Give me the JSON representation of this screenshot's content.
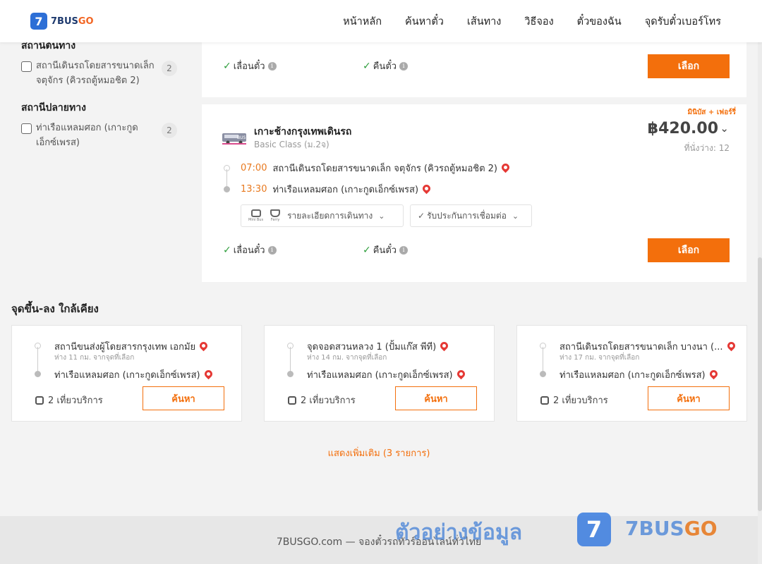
{
  "brand": {
    "logo_mark": "7",
    "name_main": "7BUS",
    "name_go": "GO"
  },
  "nav": [
    "หน้าหลัก",
    "ค้นหาตั๋ว",
    "เส้นทาง",
    "วิธีจอง",
    "ตั๋วของฉัน",
    "จุดรับตั๋วเบอร์โทร"
  ],
  "filters": {
    "origin": {
      "title": "สถานีต้นทาง",
      "items": [
        {
          "label": "สถานีเดินรถโดยสารขนาดเล็ก จตุจักร (คิวรถตู้หมอชิต 2)",
          "count": "2"
        }
      ]
    },
    "destination": {
      "title": "สถานีปลายทาง",
      "items": [
        {
          "label": "ท่าเรือแหลมศอก (เกาะกูดเอ็กซ์เพรส)",
          "count": "2"
        }
      ]
    }
  },
  "trips": [
    {
      "features": [
        "เลื่อนตั๋ว",
        "คืนตั๋ว"
      ],
      "select_label": "เลือก"
    },
    {
      "promo": "มินิบัส + เฟอร์รี่",
      "operator_logo_text": "BUS",
      "operator": "เกาะช้างกรุงเทพเดินรถ",
      "class": "Basic Class (ม.2จ)",
      "price": "฿420.00",
      "seats": "ที่นั่งว่าง: 12",
      "departure_time": "07:00",
      "departure_station": "สถานีเดินรถโดยสารขนาดเล็ก จตุจักร (คิวรถตู้หมอชิต 2)",
      "arrival_time": "13:30",
      "arrival_station": "ท่าเรือแหลมศอก (เกาะกูดเอ็กซ์เพรส)",
      "vehicles": [
        "Mini Bus",
        "Ferry"
      ],
      "details_label": "รายละเอียดการเดินทาง",
      "guarantee_label": "รับประกันการเชื่อมต่อ",
      "features": [
        "เลื่อนตั๋ว",
        "คืนตั๋ว"
      ],
      "select_label": "เลือก"
    }
  ],
  "nearby": {
    "title": "จุดขึ้น-ลง ใกล้เคียง",
    "cards": [
      {
        "from": "สถานีขนส่งผู้โดยสารกรุงเทพ เอกมัย",
        "distance": "ห่าง 11 กม. จากจุดที่เลือก",
        "to": "ท่าเรือแหลมศอก (เกาะกูดเอ็กซ์เพรส)",
        "trips": "2 เที่ยวบริการ",
        "button": "ค้นหา"
      },
      {
        "from": "จุดจอดสวนหลวง 1 (ปั้มแก๊ส พีที)",
        "distance": "ห่าง 14 กม. จากจุดที่เลือก",
        "to": "ท่าเรือแหลมศอก (เกาะกูดเอ็กซ์เพรส)",
        "trips": "2 เที่ยวบริการ",
        "button": "ค้นหา"
      },
      {
        "from": "สถานีเดินรถโดยสารขนาดเล็ก บางนา (...",
        "distance": "ห่าง 17 กม. จากจุดที่เลือก",
        "to": "ท่าเรือแหลมศอก (เกาะกูดเอ็กซ์เพรส)",
        "trips": "2 เที่ยวบริการ",
        "button": "ค้นหา"
      }
    ],
    "show_more": "แสดงเพิ่มเติม (3 รายการ)"
  },
  "footer": {
    "text": "7BUSGO.com — จองตั๋วรถทัวร์ออนไลน์ทั่วไทย"
  },
  "watermark": {
    "text": "ตัวอย่างข้อมูล",
    "mark": "7",
    "brand_main": "7BUS",
    "brand_go": "GO"
  },
  "colors": {
    "accent": "#f36f0c",
    "brand_blue": "#2d6fd6",
    "check_green": "#2e9e3c",
    "pin_red": "#e53935"
  }
}
